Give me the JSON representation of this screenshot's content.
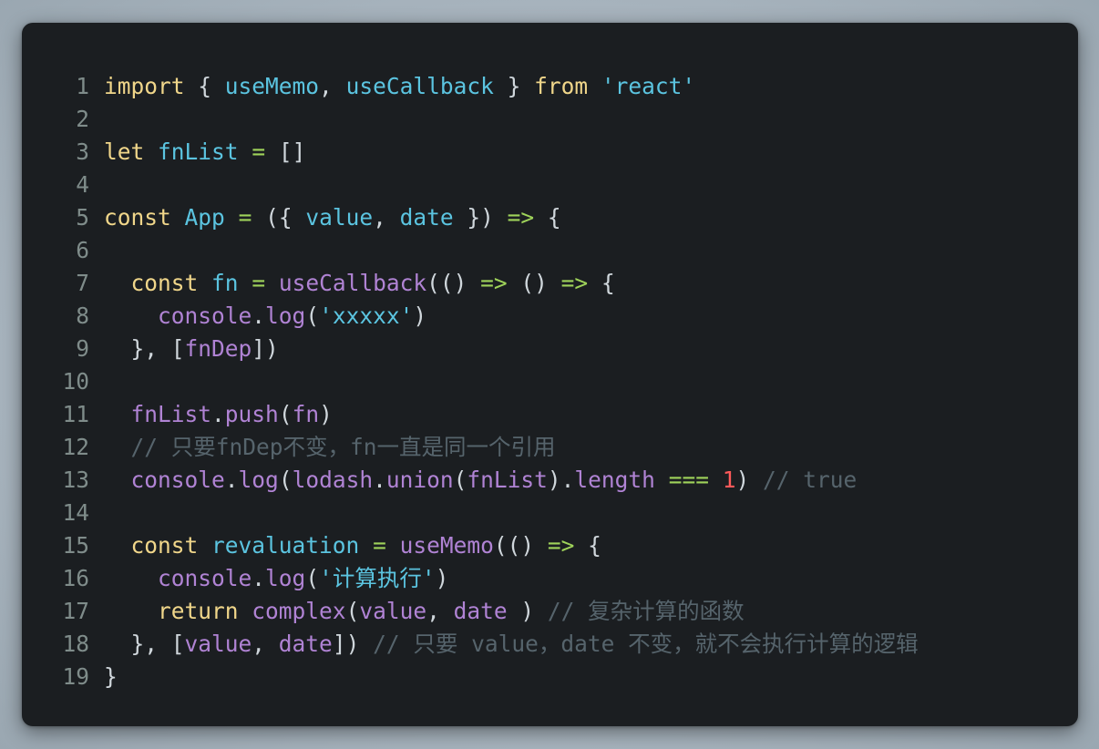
{
  "colors": {
    "background": "#a9b5bf",
    "editor_background": "#1b1e21",
    "line_number": "#7f8c8a",
    "keyword": "#f0d68a",
    "identifier": "#5bc4e0",
    "function": "#b083d4",
    "operator": "#9fd35a",
    "number": "#ff5a5a",
    "comment": "#56646c",
    "plain": "#d0d7dc"
  },
  "code": {
    "lines": [
      {
        "n": "1",
        "tokens": [
          [
            "kw",
            "import"
          ],
          [
            "pl",
            " { "
          ],
          [
            "id",
            "useMemo"
          ],
          [
            "pl",
            ", "
          ],
          [
            "id",
            "useCallback"
          ],
          [
            "pl",
            " } "
          ],
          [
            "kw",
            "from"
          ],
          [
            "pl",
            " "
          ],
          [
            "str",
            "'react'"
          ]
        ]
      },
      {
        "n": "2",
        "tokens": []
      },
      {
        "n": "3",
        "tokens": [
          [
            "kw",
            "let"
          ],
          [
            "pl",
            " "
          ],
          [
            "id",
            "fnList"
          ],
          [
            "pl",
            " "
          ],
          [
            "op",
            "="
          ],
          [
            "pl",
            " []"
          ]
        ]
      },
      {
        "n": "4",
        "tokens": []
      },
      {
        "n": "5",
        "tokens": [
          [
            "kw",
            "const"
          ],
          [
            "pl",
            " "
          ],
          [
            "id",
            "App"
          ],
          [
            "pl",
            " "
          ],
          [
            "op",
            "="
          ],
          [
            "pl",
            " ({ "
          ],
          [
            "id",
            "value"
          ],
          [
            "pl",
            ", "
          ],
          [
            "id",
            "date"
          ],
          [
            "pl",
            " }) "
          ],
          [
            "op",
            "=>"
          ],
          [
            "pl",
            " {"
          ]
        ]
      },
      {
        "n": "6",
        "tokens": []
      },
      {
        "n": "7",
        "tokens": [
          [
            "pl",
            "  "
          ],
          [
            "kw",
            "const"
          ],
          [
            "pl",
            " "
          ],
          [
            "id",
            "fn"
          ],
          [
            "pl",
            " "
          ],
          [
            "op",
            "="
          ],
          [
            "pl",
            " "
          ],
          [
            "fn",
            "useCallback"
          ],
          [
            "pl",
            "(() "
          ],
          [
            "op",
            "=>"
          ],
          [
            "pl",
            " () "
          ],
          [
            "op",
            "=>"
          ],
          [
            "pl",
            " {"
          ]
        ]
      },
      {
        "n": "8",
        "tokens": [
          [
            "pl",
            "    "
          ],
          [
            "fn",
            "console"
          ],
          [
            "pl",
            "."
          ],
          [
            "fn",
            "log"
          ],
          [
            "pl",
            "("
          ],
          [
            "str",
            "'xxxxx'"
          ],
          [
            "pl",
            ")"
          ]
        ]
      },
      {
        "n": "9",
        "tokens": [
          [
            "pl",
            "  }, ["
          ],
          [
            "fn",
            "fnDep"
          ],
          [
            "pl",
            "])"
          ]
        ]
      },
      {
        "n": "10",
        "tokens": []
      },
      {
        "n": "11",
        "tokens": [
          [
            "pl",
            "  "
          ],
          [
            "fn",
            "fnList"
          ],
          [
            "pl",
            "."
          ],
          [
            "fn",
            "push"
          ],
          [
            "pl",
            "("
          ],
          [
            "fn",
            "fn"
          ],
          [
            "pl",
            ")"
          ]
        ]
      },
      {
        "n": "12",
        "tokens": [
          [
            "pl",
            "  "
          ],
          [
            "cm",
            "// 只要fnDep不变，fn一直是同一个引用"
          ]
        ]
      },
      {
        "n": "13",
        "tokens": [
          [
            "pl",
            "  "
          ],
          [
            "fn",
            "console"
          ],
          [
            "pl",
            "."
          ],
          [
            "fn",
            "log"
          ],
          [
            "pl",
            "("
          ],
          [
            "fn",
            "lodash"
          ],
          [
            "pl",
            "."
          ],
          [
            "fn",
            "union"
          ],
          [
            "pl",
            "("
          ],
          [
            "fn",
            "fnList"
          ],
          [
            "pl",
            ")."
          ],
          [
            "fn",
            "length"
          ],
          [
            "pl",
            " "
          ],
          [
            "op",
            "==="
          ],
          [
            "pl",
            " "
          ],
          [
            "num",
            "1"
          ],
          [
            "pl",
            ") "
          ],
          [
            "cm",
            "// true"
          ]
        ]
      },
      {
        "n": "14",
        "tokens": []
      },
      {
        "n": "15",
        "tokens": [
          [
            "pl",
            "  "
          ],
          [
            "kw",
            "const"
          ],
          [
            "pl",
            " "
          ],
          [
            "id",
            "revaluation"
          ],
          [
            "pl",
            " "
          ],
          [
            "op",
            "="
          ],
          [
            "pl",
            " "
          ],
          [
            "fn",
            "useMemo"
          ],
          [
            "pl",
            "(() "
          ],
          [
            "op",
            "=>"
          ],
          [
            "pl",
            " {"
          ]
        ]
      },
      {
        "n": "16",
        "tokens": [
          [
            "pl",
            "    "
          ],
          [
            "fn",
            "console"
          ],
          [
            "pl",
            "."
          ],
          [
            "fn",
            "log"
          ],
          [
            "pl",
            "("
          ],
          [
            "str",
            "'计算执行'"
          ],
          [
            "pl",
            ")"
          ]
        ]
      },
      {
        "n": "17",
        "tokens": [
          [
            "pl",
            "    "
          ],
          [
            "kw",
            "return"
          ],
          [
            "pl",
            " "
          ],
          [
            "fn",
            "complex"
          ],
          [
            "pl",
            "("
          ],
          [
            "fn",
            "value"
          ],
          [
            "pl",
            ", "
          ],
          [
            "fn",
            "date"
          ],
          [
            "pl",
            " ) "
          ],
          [
            "cm",
            "// 复杂计算的函数"
          ]
        ]
      },
      {
        "n": "18",
        "tokens": [
          [
            "pl",
            "  }, ["
          ],
          [
            "fn",
            "value"
          ],
          [
            "pl",
            ", "
          ],
          [
            "fn",
            "date"
          ],
          [
            "pl",
            "]) "
          ],
          [
            "cm",
            "// 只要 value，date 不变，就不会执行计算的逻辑"
          ]
        ]
      },
      {
        "n": "19",
        "tokens": [
          [
            "pl",
            "}"
          ]
        ]
      }
    ]
  }
}
